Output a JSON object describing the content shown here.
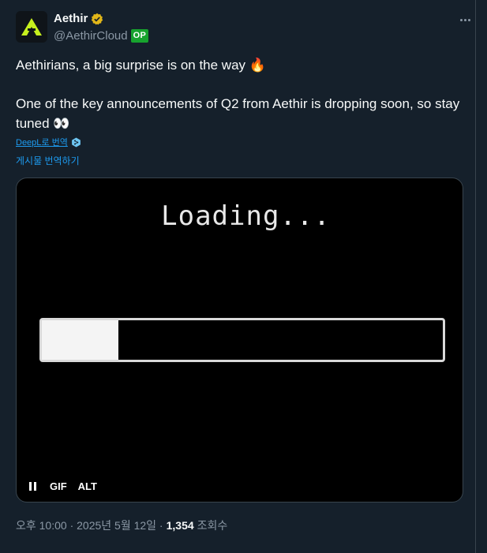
{
  "author": {
    "display_name": "Aethir",
    "handle": "@AethirCloud",
    "badge": "OP",
    "brand_color": "#c6f01e"
  },
  "tweet": {
    "line1": "Aethirians, a big surprise is on the way 🔥",
    "line2": "One of the key announcements of Q2 from Aethir is dropping soon, so stay tuned 👀"
  },
  "translate": {
    "deepl_label": "DeepL로 번역",
    "post_label": "게시물 번역하기"
  },
  "media": {
    "loading_text": "Loading...",
    "progress": 0.19,
    "gif_label": "GIF",
    "alt_label": "ALT"
  },
  "footer": {
    "timestamp": "오후 10:00 · 2025년 5월 12일 ·",
    "views": "1,354",
    "views_label": "조회수"
  }
}
